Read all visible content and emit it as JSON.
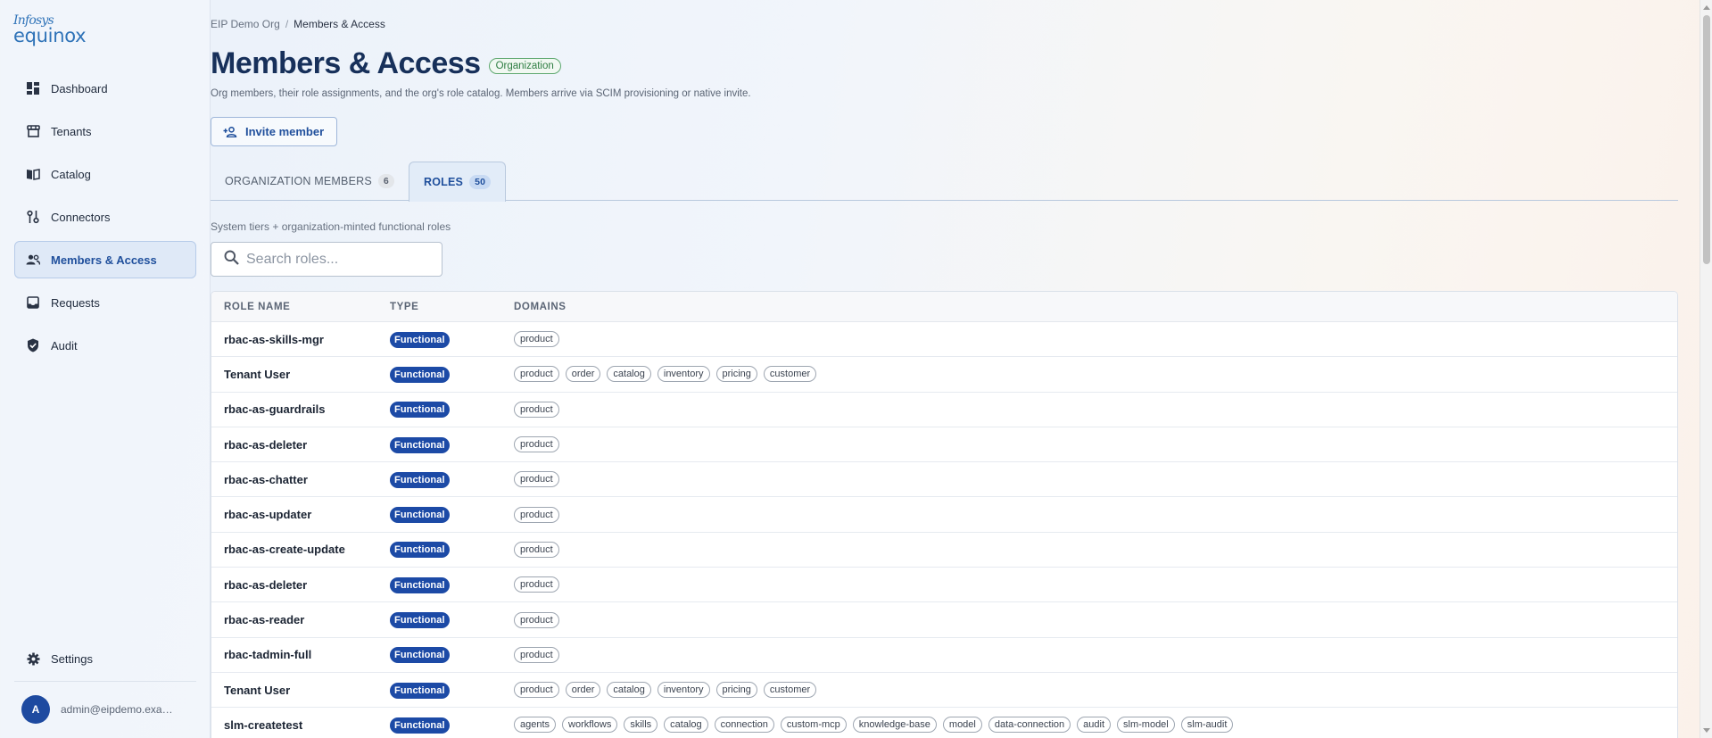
{
  "brand": {
    "line1": "Infosys",
    "line2": "equinox"
  },
  "sidebar": {
    "items": [
      {
        "label": "Dashboard",
        "icon": "dashboard-icon"
      },
      {
        "label": "Tenants",
        "icon": "storefront-icon"
      },
      {
        "label": "Catalog",
        "icon": "book-icon"
      },
      {
        "label": "Connectors",
        "icon": "connector-icon"
      },
      {
        "label": "Members & Access",
        "icon": "people-icon",
        "active": true
      },
      {
        "label": "Requests",
        "icon": "inbox-icon"
      },
      {
        "label": "Audit",
        "icon": "shield-check-icon"
      }
    ],
    "settings_label": "Settings",
    "user": {
      "initial": "A",
      "email": "admin@eipdemo.example.com"
    }
  },
  "breadcrumb": {
    "parent": "EIP Demo Org",
    "separator": "/",
    "current": "Members & Access"
  },
  "header": {
    "title": "Members & Access",
    "badge": "Organization",
    "subtitle": "Org members, their role assignments, and the org's role catalog. Members arrive via SCIM provisioning or native invite."
  },
  "invite_button": "Invite member",
  "tabs": [
    {
      "label": "ORGANIZATION MEMBERS",
      "count": "6"
    },
    {
      "label": "ROLES",
      "count": "50",
      "active": true
    }
  ],
  "roles_panel": {
    "description": "System tiers + organization-minted functional roles",
    "search_placeholder": "Search roles..."
  },
  "table": {
    "headers": {
      "name": "ROLE NAME",
      "type": "TYPE",
      "domains": "DOMAINS"
    },
    "rows": [
      {
        "name": "rbac-as-skills-mgr",
        "type": "Functional",
        "domains": [
          "product"
        ]
      },
      {
        "name": "Tenant User",
        "type": "Functional",
        "domains": [
          "product",
          "order",
          "catalog",
          "inventory",
          "pricing",
          "customer"
        ]
      },
      {
        "name": "rbac-as-guardrails",
        "type": "Functional",
        "domains": [
          "product"
        ]
      },
      {
        "name": "rbac-as-deleter",
        "type": "Functional",
        "domains": [
          "product"
        ]
      },
      {
        "name": "rbac-as-chatter",
        "type": "Functional",
        "domains": [
          "product"
        ]
      },
      {
        "name": "rbac-as-updater",
        "type": "Functional",
        "domains": [
          "product"
        ]
      },
      {
        "name": "rbac-as-create-update",
        "type": "Functional",
        "domains": [
          "product"
        ]
      },
      {
        "name": "rbac-as-deleter",
        "type": "Functional",
        "domains": [
          "product"
        ]
      },
      {
        "name": "rbac-as-reader",
        "type": "Functional",
        "domains": [
          "product"
        ]
      },
      {
        "name": "rbac-tadmin-full",
        "type": "Functional",
        "domains": [
          "product"
        ]
      },
      {
        "name": "Tenant User",
        "type": "Functional",
        "domains": [
          "product",
          "order",
          "catalog",
          "inventory",
          "pricing",
          "customer"
        ]
      },
      {
        "name": "slm-createtest",
        "type": "Functional",
        "domains": [
          "agents",
          "workflows",
          "skills",
          "catalog",
          "connection",
          "custom-mcp",
          "knowledge-base",
          "model",
          "data-connection",
          "audit",
          "slm-model",
          "slm-audit"
        ]
      }
    ]
  },
  "colors": {
    "accent": "#1f4f9c",
    "badge": "#1c4aa6",
    "org_badge": "#2e7d42",
    "avatar": "#1e4aa0"
  }
}
